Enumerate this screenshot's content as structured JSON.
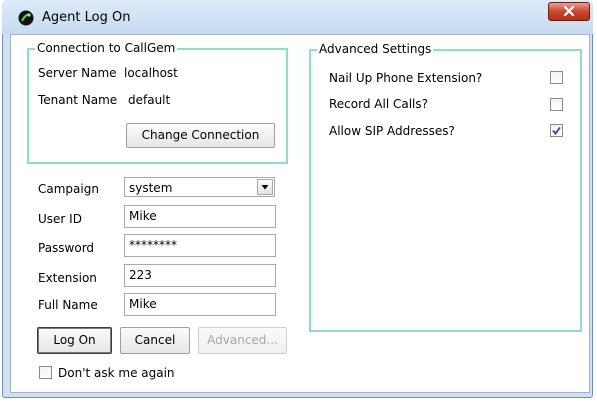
{
  "window": {
    "title": "Agent Log On",
    "close_label": "x"
  },
  "connection": {
    "legend": "Connection to CallGem",
    "server_label": "Server Name",
    "server_value": "localhost",
    "tenant_label": "Tenant Name",
    "tenant_value": "default",
    "change_button": "Change Connection"
  },
  "form": {
    "campaign_label": "Campaign",
    "campaign_value": "system",
    "userid_label": "User ID",
    "userid_value": "Mike",
    "password_label": "Password",
    "password_value": "********",
    "extension_label": "Extension",
    "extension_value": "223",
    "fullname_label": "Full Name",
    "fullname_value": "Mike"
  },
  "buttons": {
    "logon": "Log On",
    "cancel": "Cancel",
    "advanced": "Advanced..."
  },
  "dont_ask": {
    "label": "Don't ask me again",
    "checked": false
  },
  "advanced": {
    "legend": "Advanced Settings",
    "items": [
      {
        "label": "Nail Up Phone Extension?",
        "checked": false
      },
      {
        "label": "Record All Calls?",
        "checked": false
      },
      {
        "label": "Allow SIP Addresses?",
        "checked": true
      }
    ]
  },
  "colors": {
    "group_border": "#8fe0c2",
    "close_button": "#c8472f",
    "titlebar": "#d3e5f6"
  }
}
